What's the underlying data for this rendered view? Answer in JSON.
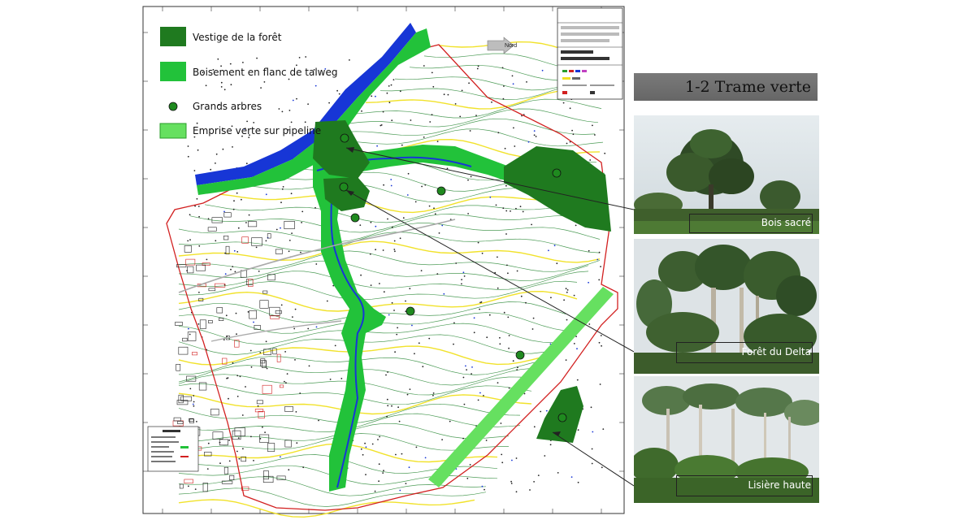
{
  "legend": {
    "items": [
      {
        "label": "Vestige de la forêt",
        "color": "#1f7a1f",
        "kind": "rect"
      },
      {
        "label": "Boisement en flanc de talweg",
        "color": "#22c23a",
        "kind": "rect"
      },
      {
        "label": "Grands arbres",
        "color": "#1f8a1f",
        "kind": "dot"
      },
      {
        "label": "Emprise verte sur pipeline",
        "color": "#66e060",
        "kind": "rect"
      }
    ]
  },
  "north": {
    "label": "Nord"
  },
  "panel": {
    "title": "1-2 Trame verte",
    "photos": [
      {
        "label": "Bois sacré"
      },
      {
        "label": "Forêt du Delta"
      },
      {
        "label": "Lisière haute"
      }
    ]
  },
  "colors": {
    "forest": "#1f7a1f",
    "talweg": "#22c23a",
    "pipeline": "#66e060",
    "water": "#1736d6",
    "contour_green": "#2e8b3a",
    "contour_yellow": "#f0e020",
    "boundary_red": "#d22020",
    "sky": "#dfe6ea",
    "photo_title_bg": "#707070"
  }
}
